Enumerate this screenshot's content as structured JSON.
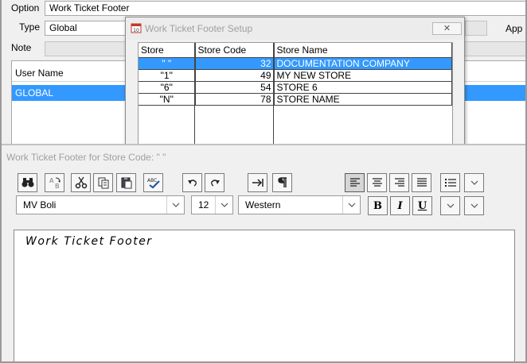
{
  "form": {
    "option_label": "Option",
    "option_value": "Work Ticket Footer",
    "type_label": "Type",
    "type_value": "Global",
    "app_label": "App",
    "note_label": "Note",
    "user_name_header": "User Name",
    "selected_user": "GLOBAL"
  },
  "dialog": {
    "title": "Work Ticket Footer Setup",
    "close_label": "✕",
    "columns": [
      "Store",
      "Store Code",
      "Store Name"
    ],
    "rows": [
      {
        "store": "\" \"",
        "code": "32",
        "name": "DOCUMENTATION COMPANY",
        "selected": true
      },
      {
        "store": "\"1\"",
        "code": "49",
        "name": "MY NEW STORE",
        "selected": false
      },
      {
        "store": "\"6\"",
        "code": "54",
        "name": "STORE 6",
        "selected": false
      },
      {
        "store": "\"N\"",
        "code": "78",
        "name": "STORE NAME",
        "selected": false
      }
    ]
  },
  "editor": {
    "title": "Work Ticket Footer for Store Code:  \" \"",
    "font_name": "MV Boli",
    "font_size": "12",
    "script": "Western",
    "bold_label": "B",
    "italic_label": "I",
    "underline_label": "U",
    "content": "Work Ticket Footer"
  },
  "icons": {
    "find": "binoculars-icon",
    "replace": "replace-icon",
    "cut": "scissors-icon",
    "copy": "copy-icon",
    "paste": "paste-icon",
    "spell": "spellcheck-icon",
    "undo": "undo-icon",
    "redo": "redo-icon",
    "tab": "tab-icon",
    "pilcrow": "pilcrow-icon",
    "align_left": "align-left-icon",
    "align_center": "align-center-icon",
    "align_right": "align-right-icon",
    "justify": "justify-icon",
    "bullets": "bullet-list-icon"
  },
  "colors": {
    "selection": "#3399ff",
    "window_bg": "#f0f0f0",
    "disabled_text": "#a0a0a0"
  }
}
